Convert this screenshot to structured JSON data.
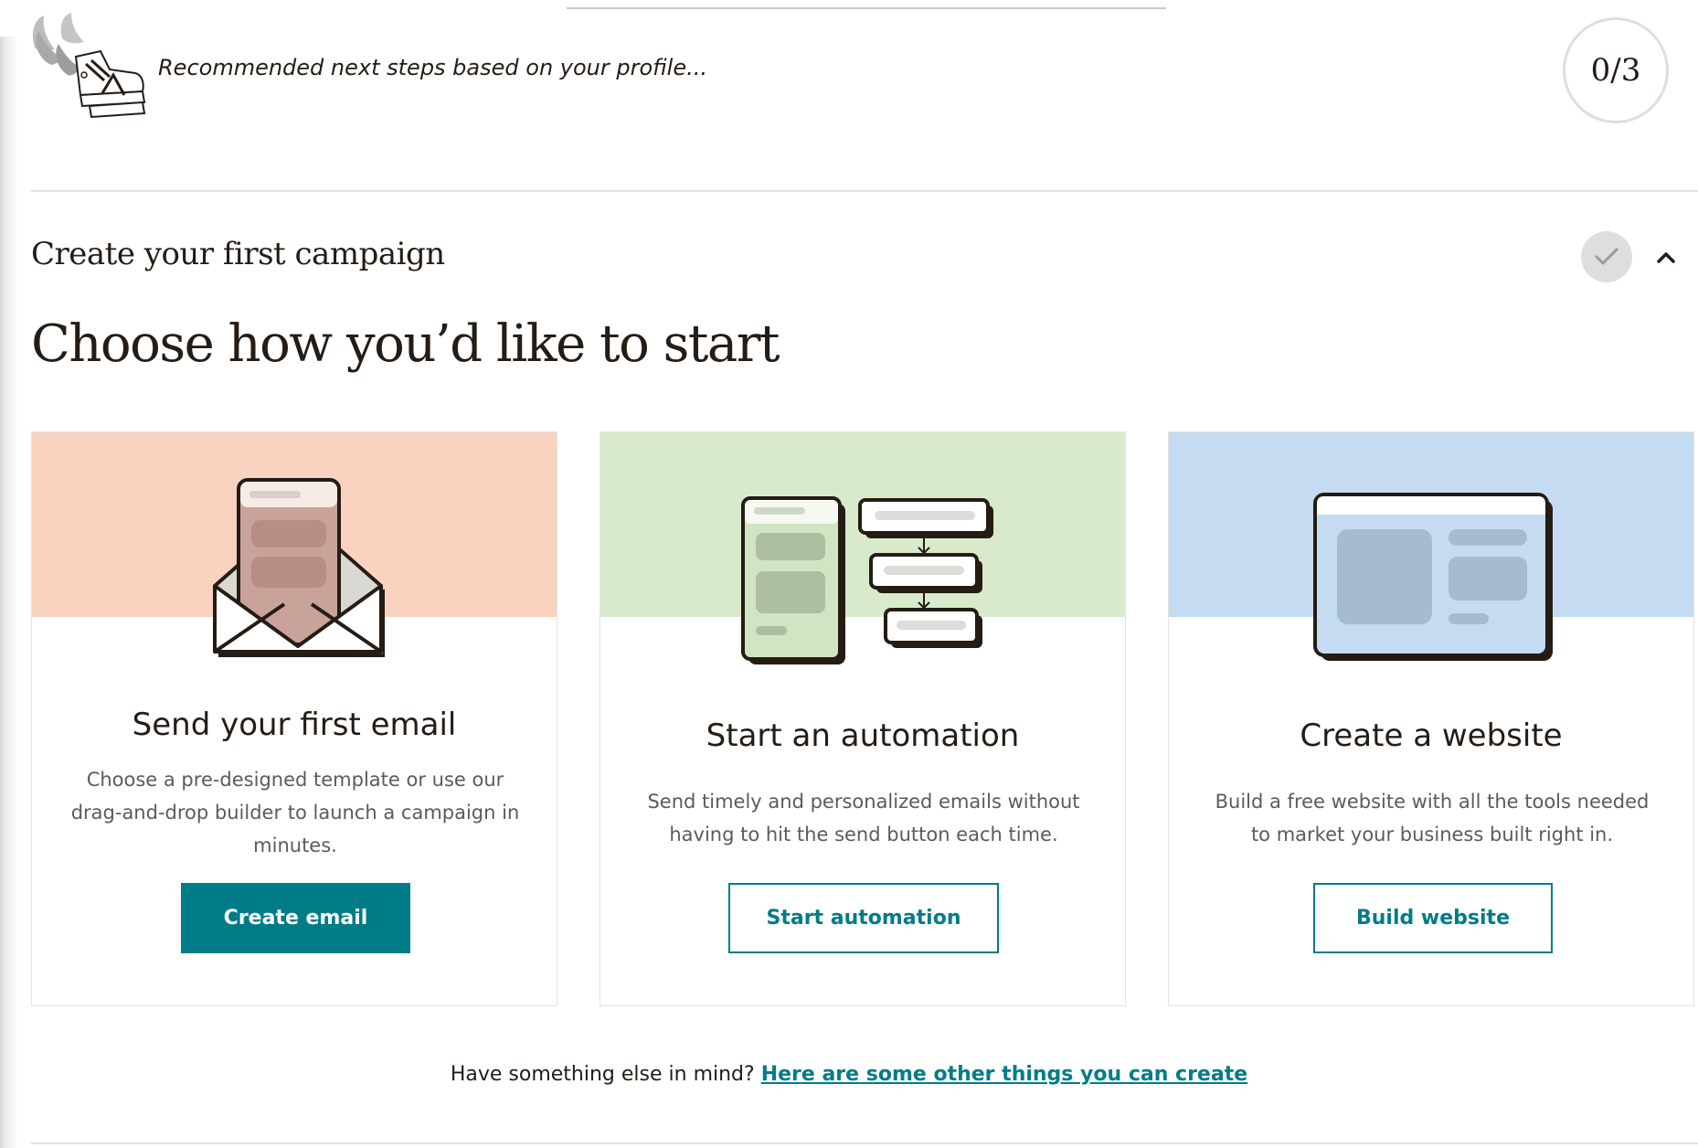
{
  "header": {
    "text": "Recommended next steps based on your profile...",
    "progress": "0/3",
    "icon": "sneaker-icon"
  },
  "step": {
    "title": "Create your first campaign",
    "check_icon": "check-icon",
    "toggle_icon": "chevron-up-icon"
  },
  "main": {
    "heading": "Choose how you’d like to start"
  },
  "cards": [
    {
      "title": "Send your first email",
      "description": "Choose a pre-designed template or use our drag-and-drop builder to launch a campaign in minutes.",
      "button": "Create email",
      "icon": "envelope-icon",
      "band_color": "#f9d2c0"
    },
    {
      "title": "Start an automation",
      "description": "Send timely and personalized emails without having to hit the send button each time.",
      "button": "Start automation",
      "icon": "automation-flow-icon",
      "band_color": "#d8eacb"
    },
    {
      "title": "Create a website",
      "description": "Build a free website with all the tools needed to market your business built right in.",
      "button": "Build website",
      "icon": "website-icon",
      "band_color": "#c4dbf1"
    }
  ],
  "footer": {
    "prompt": "Have something else in mind?",
    "link": "Here are some other things you can create"
  },
  "colors": {
    "accent": "#007c89",
    "text": "#241c15"
  }
}
